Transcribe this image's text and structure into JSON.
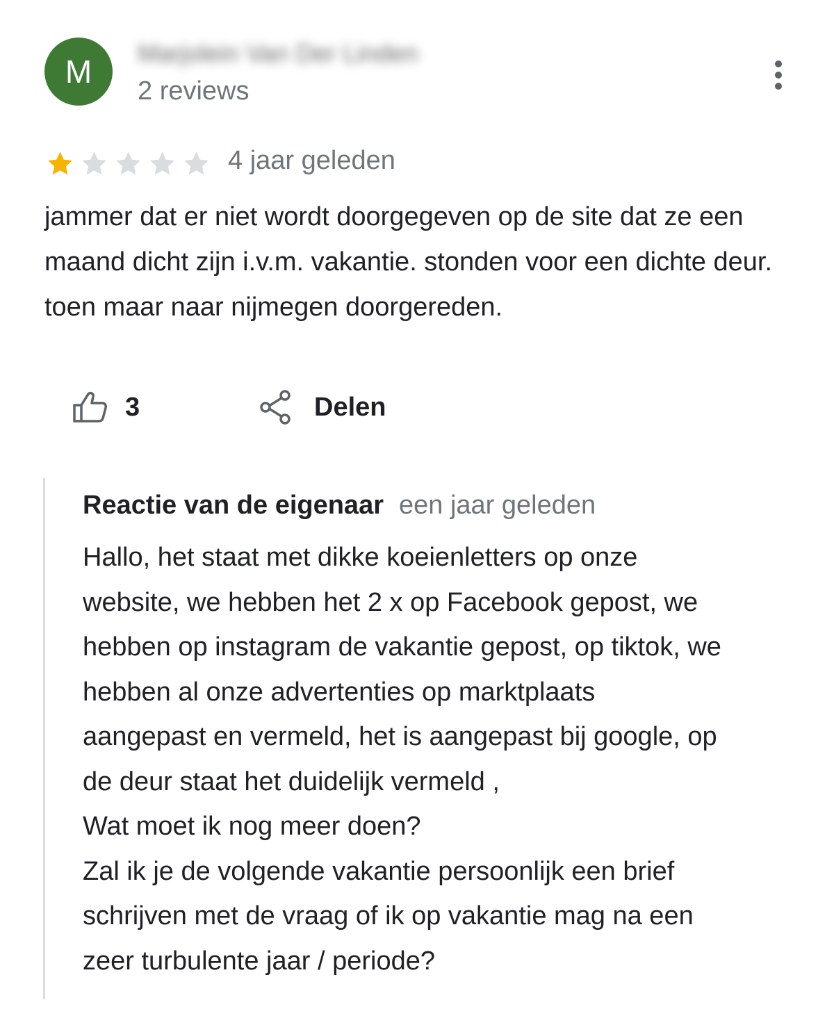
{
  "reviewer": {
    "avatar_initial": "M",
    "avatar_color": "#3f7a34",
    "name": "Marjolein Van Der Linden",
    "review_count": "2 reviews"
  },
  "review": {
    "rating": 1,
    "max_rating": 5,
    "star_color_filled": "#f4b400",
    "star_color_empty": "#dadce0",
    "time": "4 jaar geleden",
    "text": "jammer dat er niet wordt doorgegeven op de site dat ze een maand dicht zijn i.v.m. vakantie. stonden voor een dichte deur. toen maar naar nijmegen doorgereden."
  },
  "actions": {
    "like_icon": "thumbs-up-icon",
    "like_count": "3",
    "share_icon": "share-icon",
    "share_label": "Delen"
  },
  "owner_reply": {
    "title": "Reactie van de eigenaar",
    "time": "een jaar geleden",
    "lines": [
      "Hallo, het staat met dikke koeienletters op onze",
      "website, we hebben het 2 x op Facebook gepost, we",
      "hebben op instagram de vakantie gepost, op tiktok, we",
      "hebben al onze advertenties op marktplaats",
      "aangepast en vermeld, het is aangepast bij google, op",
      "de deur staat het duidelijk vermeld ,",
      "Wat moet ik nog meer doen?",
      "Zal ik je de volgende vakantie persoonlijk een brief",
      "schrijven met de vraag of ik op vakantie mag na een",
      "zeer turbulente jaar / periode?"
    ]
  }
}
